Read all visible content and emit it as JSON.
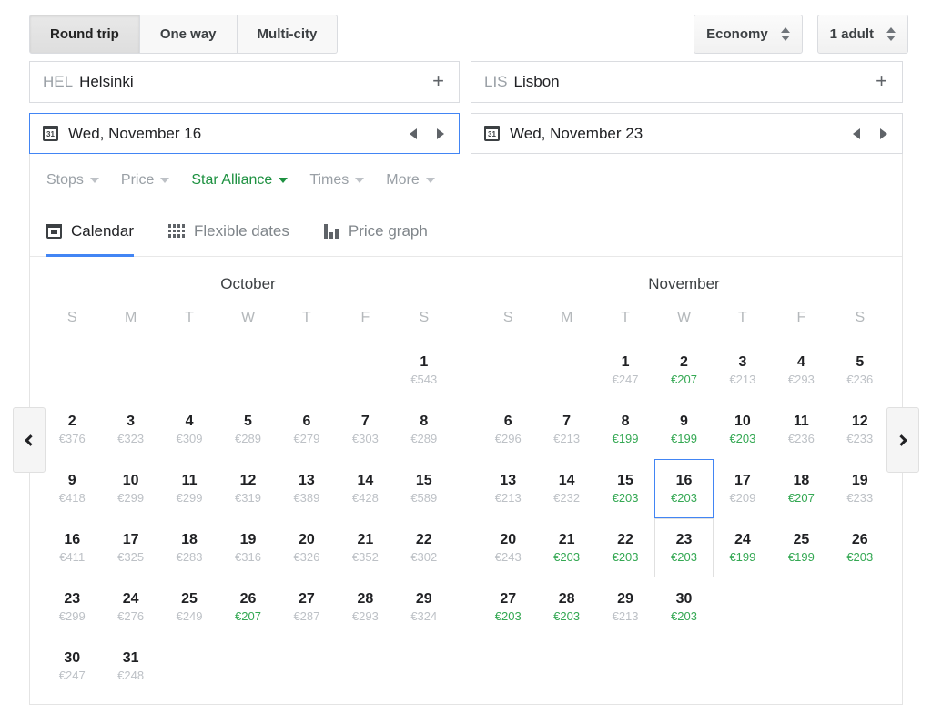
{
  "trip_types": [
    {
      "label": "Round trip",
      "active": true
    },
    {
      "label": "One way",
      "active": false
    },
    {
      "label": "Multi-city",
      "active": false
    }
  ],
  "steppers": [
    {
      "name": "cabin-class-stepper",
      "value": "Economy"
    },
    {
      "name": "passengers-stepper",
      "value": "1 adult"
    }
  ],
  "search": {
    "origin": {
      "iata": "HEL",
      "city": "Helsinki",
      "add_icon": "+"
    },
    "destination": {
      "iata": "LIS",
      "city": "Lisbon",
      "add_icon": "+"
    },
    "depart_date": {
      "label": "Wed, November 16",
      "icon_text": "31",
      "focused": true
    },
    "return_date": {
      "label": "Wed, November 23",
      "icon_text": "31",
      "focused": false
    }
  },
  "filters": [
    {
      "label": "Stops",
      "active": false
    },
    {
      "label": "Price",
      "active": false
    },
    {
      "label": "Star Alliance",
      "active": true
    },
    {
      "label": "Times",
      "active": false
    },
    {
      "label": "More",
      "active": false
    }
  ],
  "view_tabs": [
    {
      "label": "Calendar",
      "icon": "calendar-icon",
      "active": true
    },
    {
      "label": "Flexible dates",
      "icon": "grid-icon",
      "active": false
    },
    {
      "label": "Price graph",
      "icon": "bar-chart-icon",
      "active": false
    }
  ],
  "paddles": {
    "prev": "chevron-left-icon",
    "next": "chevron-right-icon"
  },
  "colors": {
    "accent_blue": "#4285f4",
    "low_price_green": "#34a853",
    "filter_active_green": "#1e9141",
    "muted_gray": "#bdc1c6"
  },
  "calendar": {
    "day_headers": [
      "S",
      "M",
      "T",
      "W",
      "T",
      "F",
      "S"
    ],
    "currency": "€",
    "months": [
      {
        "name": "October",
        "lead_blanks": 6,
        "days": [
          {
            "day": 1,
            "price": "€543",
            "low": false
          },
          {
            "day": 2,
            "price": "€376",
            "low": false
          },
          {
            "day": 3,
            "price": "€323",
            "low": false
          },
          {
            "day": 4,
            "price": "€309",
            "low": false
          },
          {
            "day": 5,
            "price": "€289",
            "low": false
          },
          {
            "day": 6,
            "price": "€279",
            "low": false
          },
          {
            "day": 7,
            "price": "€303",
            "low": false
          },
          {
            "day": 8,
            "price": "€289",
            "low": false
          },
          {
            "day": 9,
            "price": "€418",
            "low": false
          },
          {
            "day": 10,
            "price": "€299",
            "low": false
          },
          {
            "day": 11,
            "price": "€299",
            "low": false
          },
          {
            "day": 12,
            "price": "€319",
            "low": false
          },
          {
            "day": 13,
            "price": "€389",
            "low": false
          },
          {
            "day": 14,
            "price": "€428",
            "low": false
          },
          {
            "day": 15,
            "price": "€589",
            "low": false
          },
          {
            "day": 16,
            "price": "€411",
            "low": false
          },
          {
            "day": 17,
            "price": "€325",
            "low": false
          },
          {
            "day": 18,
            "price": "€283",
            "low": false
          },
          {
            "day": 19,
            "price": "€316",
            "low": false
          },
          {
            "day": 20,
            "price": "€326",
            "low": false
          },
          {
            "day": 21,
            "price": "€352",
            "low": false
          },
          {
            "day": 22,
            "price": "€302",
            "low": false
          },
          {
            "day": 23,
            "price": "€299",
            "low": false
          },
          {
            "day": 24,
            "price": "€276",
            "low": false
          },
          {
            "day": 25,
            "price": "€249",
            "low": false
          },
          {
            "day": 26,
            "price": "€207",
            "low": true
          },
          {
            "day": 27,
            "price": "€287",
            "low": false
          },
          {
            "day": 28,
            "price": "€293",
            "low": false
          },
          {
            "day": 29,
            "price": "€324",
            "low": false
          },
          {
            "day": 30,
            "price": "€247",
            "low": false
          },
          {
            "day": 31,
            "price": "€248",
            "low": false
          }
        ]
      },
      {
        "name": "November",
        "lead_blanks": 2,
        "days": [
          {
            "day": 1,
            "price": "€247",
            "low": false
          },
          {
            "day": 2,
            "price": "€207",
            "low": true
          },
          {
            "day": 3,
            "price": "€213",
            "low": false
          },
          {
            "day": 4,
            "price": "€293",
            "low": false
          },
          {
            "day": 5,
            "price": "€236",
            "low": false
          },
          {
            "day": 6,
            "price": "€296",
            "low": false
          },
          {
            "day": 7,
            "price": "€213",
            "low": false
          },
          {
            "day": 8,
            "price": "€199",
            "low": true
          },
          {
            "day": 9,
            "price": "€199",
            "low": true
          },
          {
            "day": 10,
            "price": "€203",
            "low": true
          },
          {
            "day": 11,
            "price": "€236",
            "low": false
          },
          {
            "day": 12,
            "price": "€233",
            "low": false
          },
          {
            "day": 13,
            "price": "€213",
            "low": false
          },
          {
            "day": 14,
            "price": "€232",
            "low": false
          },
          {
            "day": 15,
            "price": "€203",
            "low": true
          },
          {
            "day": 16,
            "price": "€203",
            "low": true,
            "state": "sel-start"
          },
          {
            "day": 17,
            "price": "€209",
            "low": false
          },
          {
            "day": 18,
            "price": "€207",
            "low": true
          },
          {
            "day": 19,
            "price": "€233",
            "low": false
          },
          {
            "day": 20,
            "price": "€243",
            "low": false
          },
          {
            "day": 21,
            "price": "€203",
            "low": true
          },
          {
            "day": 22,
            "price": "€203",
            "low": true
          },
          {
            "day": 23,
            "price": "€203",
            "low": true,
            "state": "sel-end"
          },
          {
            "day": 24,
            "price": "€199",
            "low": true
          },
          {
            "day": 25,
            "price": "€199",
            "low": true
          },
          {
            "day": 26,
            "price": "€203",
            "low": true
          },
          {
            "day": 27,
            "price": "€203",
            "low": true
          },
          {
            "day": 28,
            "price": "€203",
            "low": true
          },
          {
            "day": 29,
            "price": "€213",
            "low": false
          },
          {
            "day": 30,
            "price": "€203",
            "low": true
          }
        ]
      }
    ]
  }
}
